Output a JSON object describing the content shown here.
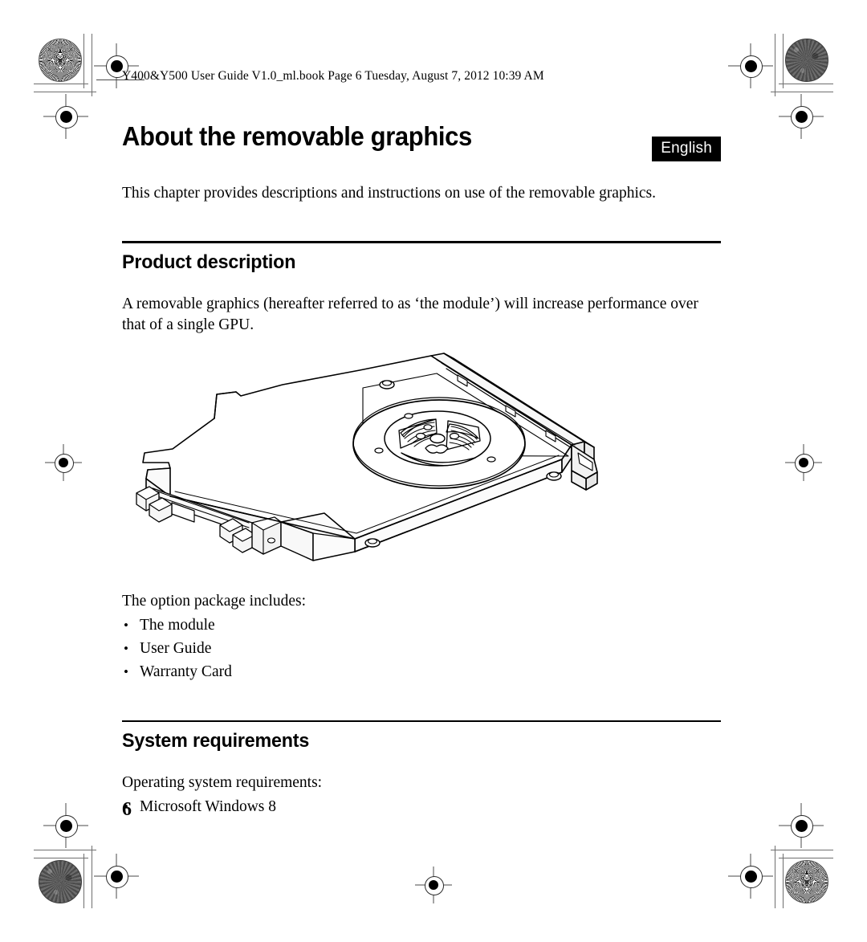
{
  "document": {
    "running_header": "Y400&Y500 User Guide V1.0_ml.book  Page 6  Tuesday, August 7, 2012  10:39 AM",
    "page_number": "6",
    "language_badge": "English",
    "title": "About the removable graphics",
    "intro": "This chapter provides descriptions and instructions on use of the removable graphics.",
    "sections": [
      {
        "heading": "Product description",
        "paragraph": "A removable graphics (hereafter referred to as ‘the module’) will increase performance over that of a single GPU.",
        "list_lead": "The option package includes:",
        "items": [
          "The module",
          "User Guide",
          "Warranty Card"
        ]
      },
      {
        "heading": "System requirements",
        "list_lead": "Operating system requirements:",
        "items": [
          "Microsoft Windows 8"
        ]
      }
    ],
    "figure": {
      "caption": "",
      "alt": "Isometric line drawing of the removable graphics module showing the cooling fan and edge connector"
    }
  },
  "print_marks": {
    "starburst_label": "radial-resolution-target",
    "density_label": "halftone-density-patch",
    "registration_label": "registration-target",
    "crop_label": "corner-crop-mark",
    "mark_color": "#000000",
    "rule_color": "#6e6e6e"
  }
}
